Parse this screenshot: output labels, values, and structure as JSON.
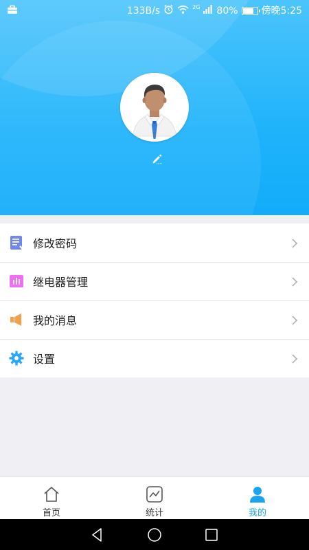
{
  "status_bar": {
    "net_speed": "133B/s",
    "network_type": "2G",
    "battery_percent": "80%",
    "battery_level": 0.8,
    "time": "傍晚5:25",
    "icons": [
      "briefcase-icon",
      "alarm-icon",
      "wifi-icon",
      "signal-icon",
      "battery-icon"
    ]
  },
  "profile": {
    "avatar_icon": "business-man-avatar",
    "edit_icon": "pencil-icon"
  },
  "menu": {
    "items": [
      {
        "label": "修改密码",
        "icon": "document-edit-icon",
        "color": "#6f86ee"
      },
      {
        "label": "继电器管理",
        "icon": "relay-bars-icon",
        "color": "#f06ef2"
      },
      {
        "label": "我的消息",
        "icon": "speaker-icon",
        "color": "#f5a04a"
      },
      {
        "label": "设置",
        "icon": "gear-icon",
        "color": "#2aa9f2"
      }
    ]
  },
  "tabbar": {
    "tabs": [
      {
        "label": "首页",
        "icon": "home-icon",
        "active": false
      },
      {
        "label": "统计",
        "icon": "chart-icon",
        "active": false
      },
      {
        "label": "我的",
        "icon": "person-icon",
        "active": true
      }
    ],
    "active_color": "#1aa3f0"
  },
  "colors": {
    "header_top": "#4cc4fb",
    "header_bottom": "#12acfa",
    "page_background": "#efeff4"
  }
}
